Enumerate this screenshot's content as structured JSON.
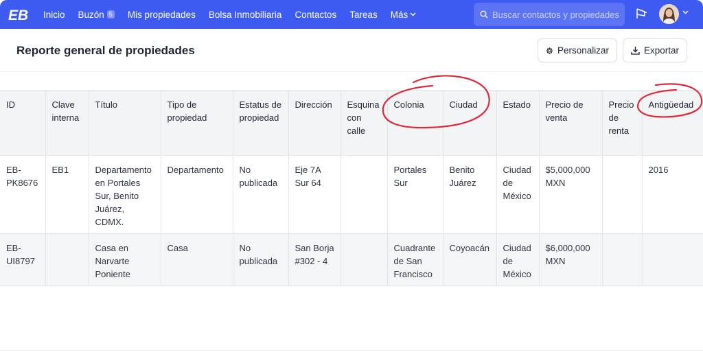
{
  "nav": {
    "items": [
      {
        "label": "Inicio"
      },
      {
        "label": "Buzón",
        "badge": "5"
      },
      {
        "label": "Mis propiedades"
      },
      {
        "label": "Bolsa Inmobiliaria"
      },
      {
        "label": "Contactos"
      },
      {
        "label": "Tareas"
      },
      {
        "label": "Más"
      }
    ],
    "search_placeholder": "Buscar contactos y propiedades"
  },
  "page": {
    "title": "Reporte general de propiedades",
    "customize_label": "Personalizar",
    "export_label": "Exportar"
  },
  "table": {
    "headers": [
      "ID",
      "Clave interna",
      "Título",
      "Tipo de propiedad",
      "Estatus de propiedad",
      "Dirección",
      "Esquina con calle",
      "Colonia",
      "Ciudad",
      "Estado",
      "Precio de venta",
      "Precio de renta",
      "Antigüedad"
    ],
    "rows": [
      [
        "EB-PK8676",
        "EB1",
        "Departamento en Portales Sur, Benito Juárez, CDMX.",
        "Departamento",
        "No publicada",
        "Eje 7A Sur 64",
        "",
        "Portales Sur",
        "Benito Juárez",
        "Ciudad de México",
        "$5,000,000 MXN",
        "",
        "2016"
      ],
      [
        "EB-UI8797",
        "",
        "Casa en Narvarte Poniente",
        "Casa",
        "No publicada",
        "San Borja #302 - 4",
        "",
        "Cuadrante de San Francisco",
        "Coyoacán",
        "Ciudad de México",
        "$6,000,000 MXN",
        "",
        ""
      ]
    ]
  },
  "colors": {
    "brand": "#3d5af1",
    "annotation": "#e0283a"
  }
}
